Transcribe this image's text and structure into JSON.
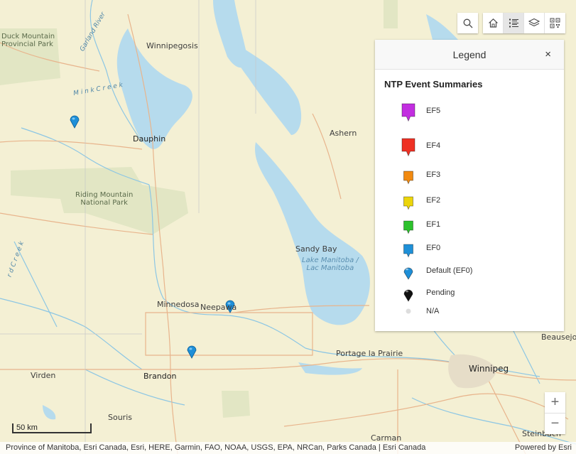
{
  "map": {
    "places": {
      "winnipegosis": "Winnipegosis",
      "dauphin": "Dauphin",
      "ashern": "Ashern",
      "sandy_bay": "Sandy Bay",
      "minnedosa": "Minnedosa",
      "neepawa": "Neepawa",
      "portage": "Portage la Prairie",
      "winnipeg": "Winnipeg",
      "virden": "Virden",
      "brandon": "Brandon",
      "souris": "Souris",
      "carman": "Carman",
      "steinbach": "Steinbach",
      "beausejour": "Beausejo"
    },
    "parks": {
      "duck_mountain_1": "Duck Mountain",
      "duck_mountain_2": "Provincial Park",
      "riding_mountain_1": "Riding Mountain",
      "riding_mountain_2": "National Park"
    },
    "lakes": {
      "manitoba_1": "Lake Manitoba /",
      "manitoba_2": "Lac Manitoba"
    },
    "rivers": {
      "garland": "Garland River",
      "mink": "M i n k  C r e e k",
      "creek": "r d  C r e e k"
    },
    "colors": {
      "land": "#f4f0d4",
      "water": "#b6dbed",
      "park": "#e2e6c4",
      "road": "#e8b48c",
      "marker_ef0_default": "#1e8fd8"
    }
  },
  "toolbar": {
    "search_icon": "search-icon",
    "home_icon": "home-icon",
    "legend_icon": "legend-list-icon",
    "layers_icon": "layers-icon",
    "qr_icon": "qr-code-icon"
  },
  "legend": {
    "title": "Legend",
    "close_label": "×",
    "layer_title": "NTP Event Summaries",
    "items": [
      {
        "label": "EF5",
        "color": "#c22ee0",
        "icon": "pushpin-square"
      },
      {
        "label": "EF4",
        "color": "#ee3124",
        "icon": "pushpin-square"
      },
      {
        "label": "EF3",
        "color": "#f28a10",
        "icon": "pushpin-square"
      },
      {
        "label": "EF2",
        "color": "#ecd50a",
        "icon": "pushpin-square"
      },
      {
        "label": "EF1",
        "color": "#2cc22c",
        "icon": "pushpin-square"
      },
      {
        "label": "EF0",
        "color": "#1e90d8",
        "icon": "pushpin-square"
      },
      {
        "label": "Default (EF0)",
        "color": "#1e8fd8",
        "icon": "pushpin-round"
      },
      {
        "label": "Pending",
        "color": "#111111",
        "icon": "pushpin-round"
      },
      {
        "label": "N/A",
        "color": "#dddddd",
        "icon": "dot"
      }
    ]
  },
  "zoom": {
    "in_label": "+",
    "out_label": "−"
  },
  "scale": {
    "label": "50 km"
  },
  "attribution": {
    "sources": "Province of Manitoba, Esri Canada, Esri, HERE, Garmin, FAO, NOAA, USGS, EPA, NRCan, Parks Canada | Esri Canada",
    "powered_by": "Powered by Esri"
  }
}
